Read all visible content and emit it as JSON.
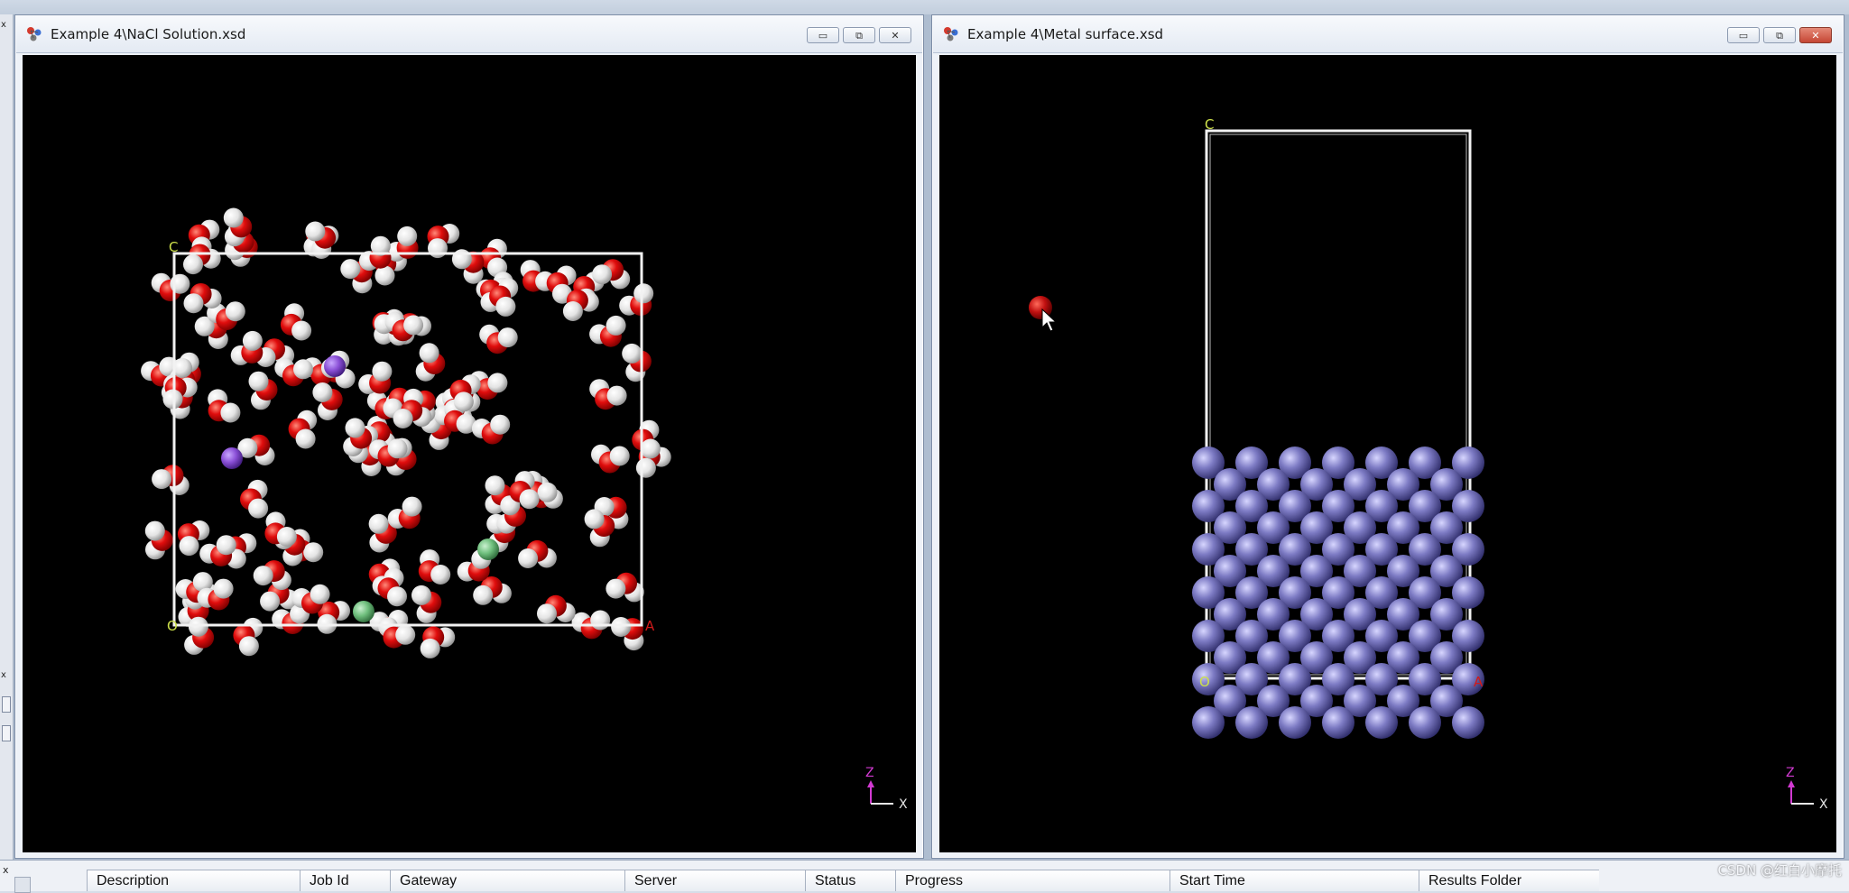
{
  "windows": [
    {
      "title": "Example 4\\NaCl Solution.xsd",
      "axis": {
        "z": "Z",
        "x": "X"
      },
      "lattice": {
        "origin": "O",
        "a": "A",
        "c": "C"
      },
      "atom_colors": {
        "oxygen": "#e00d0d",
        "hydrogen": "#e9e9e9",
        "sodium": "#8a4fd6",
        "chlorine": "#6fbf7d"
      }
    },
    {
      "title": "Example 4\\Metal surface.xsd",
      "axis": {
        "z": "Z",
        "x": "X"
      },
      "lattice": {
        "origin": "O",
        "a": "A",
        "c": "C"
      },
      "atom_colors": {
        "metal": "#7d7bc4",
        "stray_oxygen": "#c11010"
      }
    }
  ],
  "window_buttons": {
    "minimize": "▭",
    "restore": "⧉",
    "close": "✕"
  },
  "jobs_table": {
    "columns": [
      "Description",
      "Job Id",
      "Gateway",
      "Server",
      "Status",
      "Progress",
      "Start Time",
      "Results Folder"
    ]
  },
  "left_gutter": {
    "close_a": "x",
    "close_b": "x"
  },
  "watermark": "CSDN @红白小摩托",
  "colors": {
    "viewport_bg": "#000000",
    "cell_line": "#f2f2f2",
    "axis_z": "#d23ad2",
    "axis_x": "#e6e6e6",
    "axis_label_a": "#d21a1a"
  }
}
